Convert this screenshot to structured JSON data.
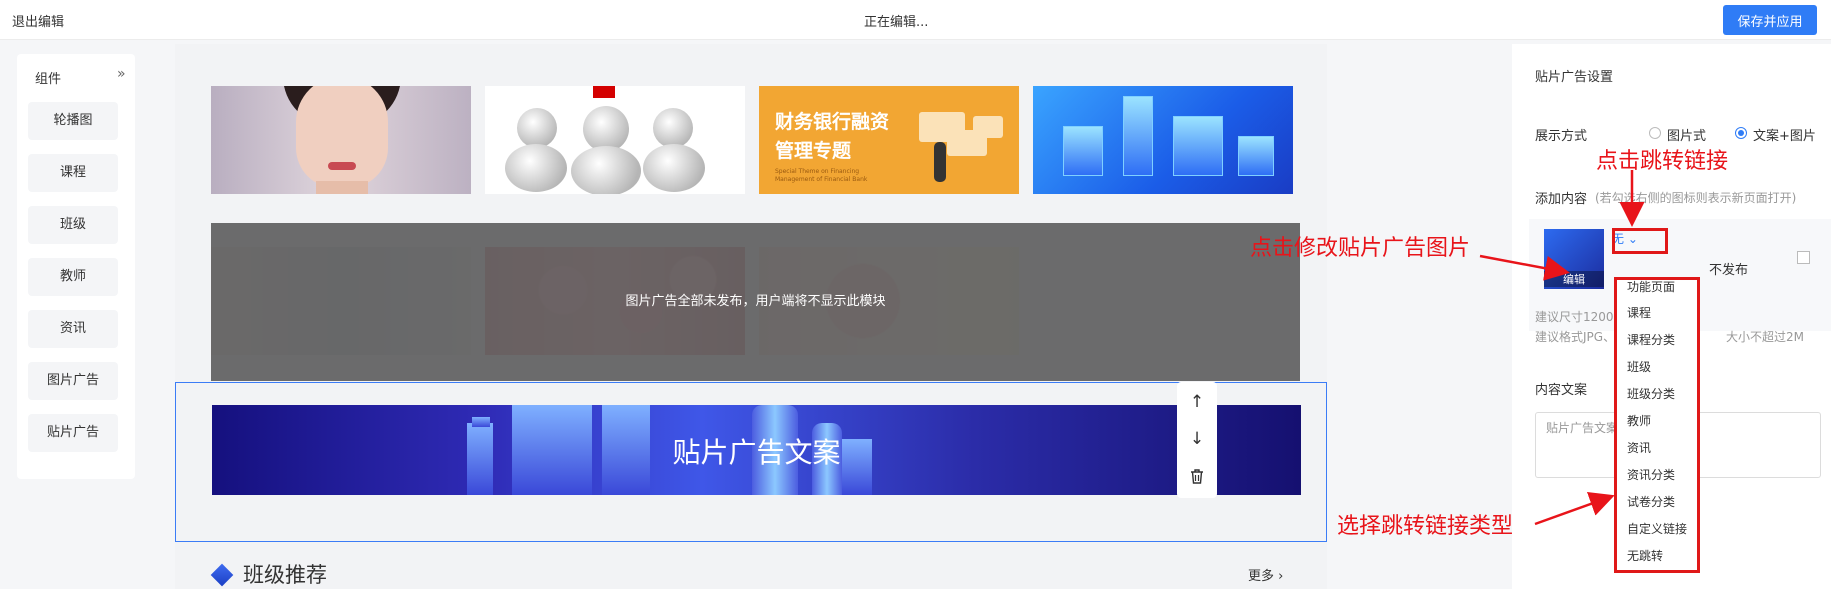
{
  "topbar": {
    "exit_label": "退出编辑",
    "status": "正在编辑...",
    "save_label": "保存并应用"
  },
  "components": {
    "title": "组件",
    "toggle_icon": "double-chevron-right-icon",
    "items": [
      "轮播图",
      "课程",
      "班级",
      "教师",
      "资讯",
      "图片广告",
      "贴片广告"
    ]
  },
  "canvas": {
    "finance_title": "财务银行融资管理专题",
    "finance_title_line1": "财务银行融资",
    "finance_title_line2": "管理专题",
    "finance_sub": "Special Theme on Financing Management of Financial Bank",
    "unpublished_overlay": "图片广告全部未发布，用户端将不显示此模块",
    "banner_text": "贴片广告文案",
    "section_title": "班级推荐",
    "more_label": "更多",
    "tools": [
      "arrow-up-icon",
      "arrow-down-icon",
      "trash-icon"
    ]
  },
  "settings": {
    "title": "贴片广告设置",
    "display_label": "展示方式",
    "display_options": [
      "图片式",
      "文案+图片"
    ],
    "display_selected": "文案+图片",
    "add_content_label": "添加内容",
    "add_content_hint": "(若勾选右侧的图标则表示新页面打开)",
    "thumb_label": "编辑",
    "link_value": "无",
    "publish_label": "不发布",
    "size_hint_1": "建议尺寸1200",
    "size_hint_1b": "",
    "size_hint_2": "建议格式JPG、",
    "size_hint_2b": "大小不超过2M",
    "copy_label": "内容文案",
    "copy_value": "贴片广告文案"
  },
  "dropdown": {
    "items": [
      "功能页面",
      "课程",
      "课程分类",
      "班级",
      "班级分类",
      "教师",
      "资讯",
      "资讯分类",
      "试卷分类",
      "自定义链接",
      "无跳转"
    ]
  },
  "annotations": {
    "click_link": "点击跳转链接",
    "click_image": "点击修改贴片广告图片",
    "choose_type": "选择跳转链接类型"
  },
  "colors": {
    "accent": "#2f7cf6",
    "annotation": "#e8141a"
  }
}
